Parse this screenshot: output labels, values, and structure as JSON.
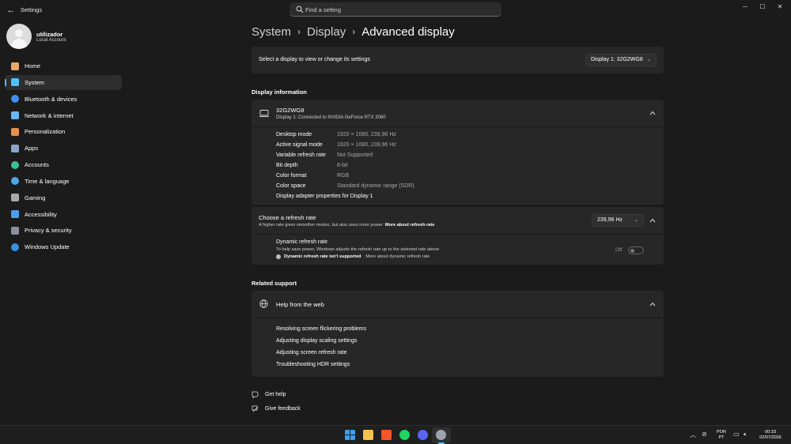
{
  "window": {
    "title": "Settings",
    "search_placeholder": "Find a setting",
    "controls": {
      "minimize": "─",
      "maximize": "☐",
      "close": "✕"
    }
  },
  "user": {
    "name": "utilizador",
    "account_type": "Local Account"
  },
  "sidebar": {
    "items": [
      {
        "label": "Home",
        "icon": "home-icon",
        "color": "#e8a96a"
      },
      {
        "label": "System",
        "icon": "system-icon",
        "color": "#4cc2ff",
        "active": true
      },
      {
        "label": "Bluetooth & devices",
        "icon": "bluetooth-icon",
        "color": "#3f8ef0"
      },
      {
        "label": "Network & internet",
        "icon": "network-icon",
        "color": "#6ab7f5"
      },
      {
        "label": "Personalization",
        "icon": "brush-icon",
        "color": "#e88f4c"
      },
      {
        "label": "Apps",
        "icon": "apps-icon",
        "color": "#8ba4c9"
      },
      {
        "label": "Accounts",
        "icon": "accounts-icon",
        "color": "#3ec08f"
      },
      {
        "label": "Time & language",
        "icon": "globe-clock-icon",
        "color": "#4aa8e8"
      },
      {
        "label": "Gaming",
        "icon": "gaming-icon",
        "color": "#a8a8a8"
      },
      {
        "label": "Accessibility",
        "icon": "accessibility-icon",
        "color": "#4a9fe8"
      },
      {
        "label": "Privacy & security",
        "icon": "shield-icon",
        "color": "#8a8f9a"
      },
      {
        "label": "Windows Update",
        "icon": "update-icon",
        "color": "#3b8fe0"
      }
    ]
  },
  "breadcrumb": [
    "System",
    "Display",
    "Advanced display"
  ],
  "select_display": {
    "label": "Select a display to view or change its settings",
    "value": "Display 1: 32G2WG8"
  },
  "display_info": {
    "section_title": "Display information",
    "monitor_name": "32G2WG8",
    "monitor_desc": "Display 1: Connected to NVIDIA GeForce RTX 3060",
    "rows": [
      {
        "key": "Desktop mode",
        "value": "1920 × 1080, 239,96 Hz"
      },
      {
        "key": "Active signal mode",
        "value": "1920 × 1080, 239,96 Hz"
      },
      {
        "key": "Variable refresh rate",
        "value": "Not Supported"
      },
      {
        "key": "Bit depth",
        "value": "8-bit"
      },
      {
        "key": "Color format",
        "value": "RGB"
      },
      {
        "key": "Color space",
        "value": "Standard dynamic range (SDR)"
      }
    ],
    "adapter_link": "Display adapter properties for Display 1"
  },
  "refresh": {
    "title": "Choose a refresh rate",
    "desc": "A higher rate gives smoother motion, but also uses more power",
    "desc_link": "More about refresh rate",
    "value": "239,96 Hz",
    "dynamic": {
      "title": "Dynamic refresh rate",
      "desc": "To help save power, Windows adjusts the refresh rate up to the selected rate above",
      "warning": "Dynamic refresh rate isn't supported",
      "warning_link": "More about dynamic refresh rate",
      "toggle_label": "Off"
    }
  },
  "related": {
    "section_title": "Related support",
    "help_title": "Help from the web",
    "links": [
      "Resolving screen flickering problems",
      "Adjusting display scaling settings",
      "Adjusting screen refresh rate",
      "Troubleshooting HDR settings"
    ]
  },
  "footer": {
    "get_help": "Get help",
    "give_feedback": "Give feedback"
  },
  "taskbar": {
    "apps": [
      {
        "icon": "windows-start-icon",
        "color": "#3aa0f0"
      },
      {
        "icon": "file-explorer-icon",
        "color": "#f2c14e"
      },
      {
        "icon": "brave-browser-icon",
        "color": "#f2552c"
      },
      {
        "icon": "spotify-icon",
        "color": "#1ed760"
      },
      {
        "icon": "discord-icon",
        "color": "#5865f2"
      },
      {
        "icon": "settings-app-icon",
        "color": "#9aa4b2"
      }
    ],
    "lang_top": "POR",
    "lang_bottom": "PT",
    "time": "00:33",
    "date": "02/07/2026"
  }
}
